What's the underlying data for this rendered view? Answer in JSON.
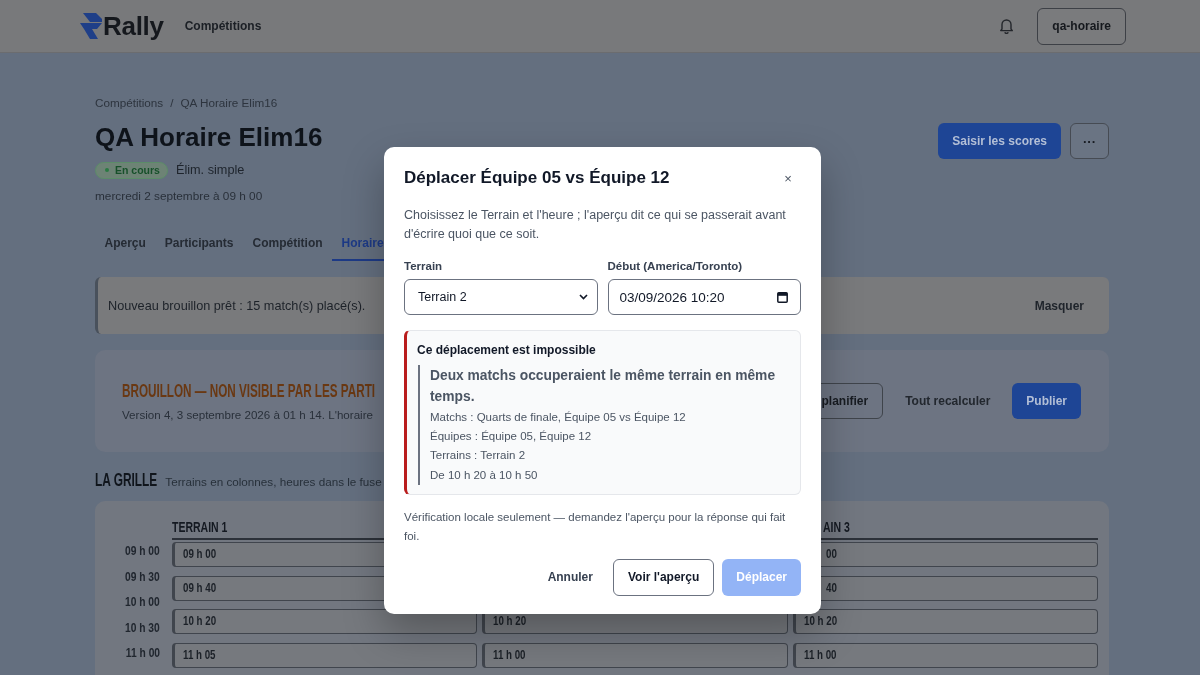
{
  "header": {
    "brand": "Rally",
    "nav_link": "Compétitions",
    "user_button": "qa-horaire"
  },
  "breadcrumb": {
    "items": [
      "Compétitions",
      "QA Horaire Elim16"
    ],
    "separator": "/"
  },
  "page": {
    "title": "QA Horaire Elim16",
    "status_badge": "En cours",
    "format": "Élim. simple",
    "date": "mercredi 2 septembre à 09 h 00",
    "actions": [
      {
        "label": "Saisir les scores",
        "kind": "primary"
      },
      {
        "label": "···",
        "kind": "icon"
      }
    ]
  },
  "tabs": [
    {
      "label": "Aperçu",
      "selected": false
    },
    {
      "label": "Participants",
      "selected": false
    },
    {
      "label": "Compétition",
      "selected": false
    },
    {
      "label": "Horaire",
      "selected": true
    }
  ],
  "notice": {
    "text": "Nouveau brouillon prêt : 15 match(s) placé(s).",
    "dismiss": "Masquer"
  },
  "draft": {
    "title": "BROUILLON — NON VISIBLE PAR LES PARTI",
    "subtitle": "Version 4, 3 septembre 2026 à 01 h 14. L'horaire",
    "actions": [
      {
        "label": "planifier",
        "kind": "outline"
      },
      {
        "label": "Tout recalculer",
        "kind": "text"
      },
      {
        "label": "Publier",
        "kind": "primary"
      }
    ]
  },
  "grid": {
    "title": "LA GRILLE",
    "subtitle": "Terrains en colonnes, heures dans le fuse",
    "times": [
      "09 h 00",
      "09 h 30",
      "10 h 00",
      "10 h 30",
      "11 h 00"
    ],
    "columns": [
      {
        "heading": "TERRAIN 1",
        "kind": "full",
        "entries": [
          {
            "time": "09 h 00",
            "kind": "full"
          },
          {
            "time": "09 h 40",
            "kind": "full"
          },
          {
            "time": "10 h 20",
            "kind": "full"
          },
          {
            "time": "11 h 05",
            "kind": "full"
          }
        ]
      },
      {
        "entries": [
          {
            "time": "10 h 20",
            "kind": "full"
          },
          {
            "time": "11 h 00",
            "kind": "full"
          }
        ]
      },
      {
        "heading": "AIN 3",
        "kind": "clipped",
        "entries": [
          {
            "time": "00",
            "kind": "clipped"
          },
          {
            "time": "40",
            "kind": "clipped"
          },
          {
            "time": "10 h 20",
            "kind": "full"
          },
          {
            "time": "11 h 00",
            "kind": "full"
          }
        ]
      }
    ]
  },
  "dialog": {
    "title": "Déplacer Équipe 05 vs Équipe 12",
    "close": "×",
    "description": "Choisissez le Terrain et l'heure ; l'aperçu dit ce qui se passerait avant d'écrire quoi que ce soit.",
    "fields": [
      {
        "label": "Terrain",
        "kind": "select",
        "value": "Terrain 2"
      },
      {
        "label": "Début (America/Toronto)",
        "kind": "datetime",
        "value": "03/09/2026 10:20"
      }
    ],
    "error": {
      "title": "Ce déplacement est impossible",
      "headline": "Deux matchs occuperaient le même terrain en même temps.",
      "details": [
        "Matchs : Quarts de finale, Équipe 05 vs Équipe 12",
        "Équipes : Équipe 05, Équipe 12",
        "Terrains : Terrain 2",
        "De 10 h 20 à 10 h 50"
      ]
    },
    "note": "Vérification locale seulement — demandez l'aperçu pour la réponse qui fait foi.",
    "buttons": [
      {
        "label": "Annuler",
        "kind": "text",
        "disabled": false
      },
      {
        "label": "Voir l'aperçu",
        "kind": "outline",
        "disabled": false
      },
      {
        "label": "Déplacer",
        "kind": "primary",
        "disabled": true
      }
    ]
  }
}
